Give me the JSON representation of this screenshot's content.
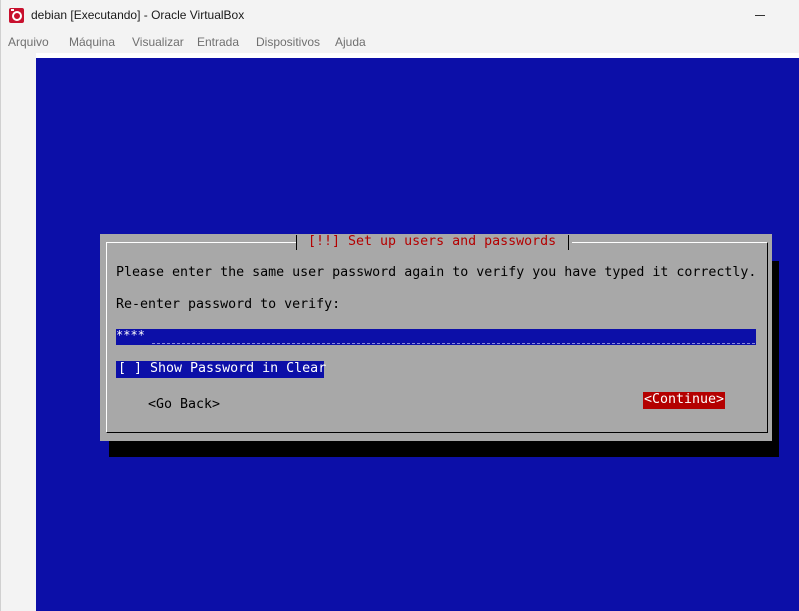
{
  "window": {
    "title": "debian [Executando] - Oracle VirtualBox"
  },
  "menubar": {
    "items": [
      {
        "label": "Arquivo"
      },
      {
        "label": "Máquina"
      },
      {
        "label": "Visualizar"
      },
      {
        "label": "Entrada"
      },
      {
        "label": "Dispositivos"
      },
      {
        "label": "Ajuda"
      }
    ]
  },
  "installer": {
    "dialog_title": "[!!] Set up users and passwords",
    "instruction": "Please enter the same user password again to verify you have typed it correctly.",
    "field_label": "Re-enter password to verify:",
    "password_value": "****",
    "show_password_label": "[ ] Show Password in Clear",
    "go_back_label": "<Go Back>",
    "continue_label": "<Continue>"
  },
  "colors": {
    "screen_background": "#0c0fa8",
    "dialog_background": "#a8a8a8",
    "title_text": "#b40000",
    "selected_button": "#b40000"
  },
  "icons": {
    "app": "virtualbox-icon",
    "minimize": "minimize-icon"
  }
}
